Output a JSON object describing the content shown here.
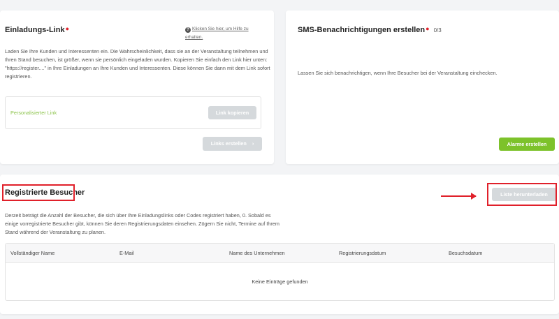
{
  "invite": {
    "title": "Einladungs-Link",
    "help_icon": "?",
    "help_link": "Klicken Sie hier, um Hilfe zu erhalten.",
    "description": "Laden Sie Ihre Kunden und Interessenten ein. Die Wahrscheinlichkeit, dass sie an der Veranstaltung teilnehmen und Ihren Stand besuchen, ist größer, wenn sie persönlich eingeladen wurden. Kopieren Sie einfach den Link hier unten: \"https://register....\" in Ihre Einladungen an Ihre Kunden und Interessenten. Diese können Sie dann mit dem Link sofort registrieren.",
    "personal_link_label": "Personalisierter Link",
    "copy_button": "Link kopieren",
    "create_links_button": "Links erstellen",
    "chevron_icon": "›"
  },
  "sms": {
    "title": "SMS-Benachrichtigungen erstellen",
    "count": "0/3",
    "description": "Lassen Sie sich benachrichtigen, wenn Ihre Besucher bei der Veranstaltung einchecken.",
    "alarm_button": "Alarme erstellen"
  },
  "visitors": {
    "title": "Registrierte Besucher",
    "download_button": "Liste herunterladen",
    "description": "Derzeit beträgt die Anzahl der Besucher, die sich über Ihre Einladungslinks oder Codes registriert haben, 0. Sobald es einige vorregistrierte Besucher gibt, können Sie deren Registrierungsdaten einsehen. Zögern Sie nicht, Termine auf Ihrem Stand während der Veranstaltung zu planen.",
    "columns": [
      "Vollständiger Name",
      "E-Mail",
      "Name des Unternehmen",
      "Registrierungsdatum",
      "Besuchsdatum"
    ],
    "empty_message": "Keine Einträge gefunden"
  },
  "colors": {
    "accent_green": "#7dc22b",
    "disabled_button": "#d5d9dc",
    "required_marker": "#e0202a",
    "annotation_red": "#e0202a"
  }
}
